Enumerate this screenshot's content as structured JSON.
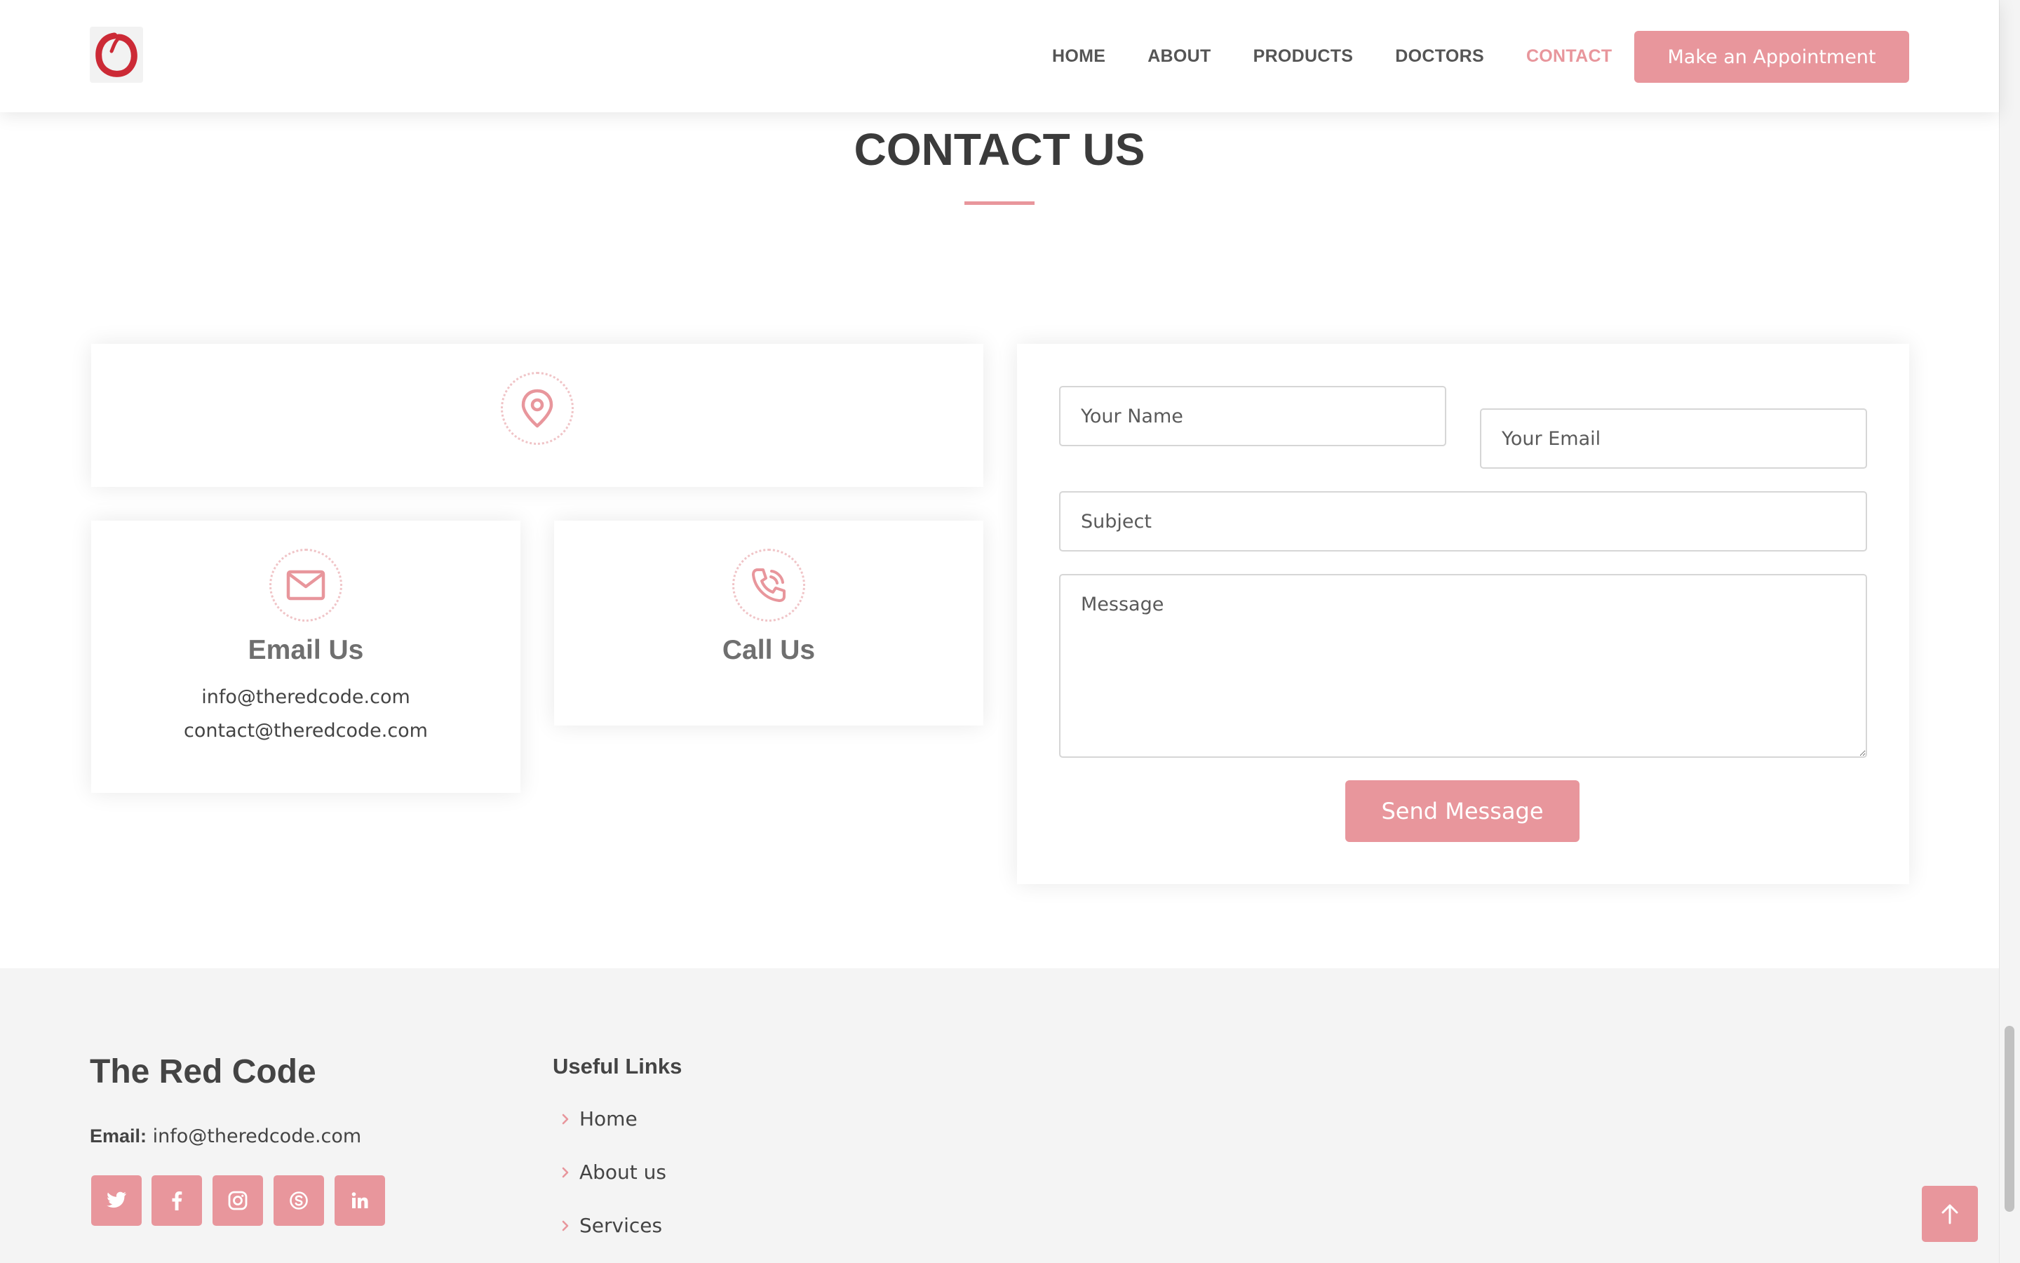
{
  "header": {
    "nav": [
      "HOME",
      "ABOUT",
      "PRODUCTS",
      "DOCTORS",
      "CONTACT"
    ],
    "active_nav": "CONTACT",
    "appointment_label": "Make an Appointment"
  },
  "section": {
    "title": "CONTACT US"
  },
  "info": {
    "location_icon": "map-pin-icon",
    "email": {
      "icon": "envelope-icon",
      "heading": "Email Us",
      "lines": [
        "info@theredcode.com",
        "contact@theredcode.com"
      ]
    },
    "call": {
      "icon": "phone-call-icon",
      "heading": "Call Us"
    }
  },
  "form": {
    "name_placeholder": "Your Name",
    "email_placeholder": "Your Email",
    "subject_placeholder": "Subject",
    "message_placeholder": "Message",
    "send_label": "Send Message"
  },
  "footer": {
    "brand": "The Red Code",
    "email_label": "Email:",
    "email_value": "info@theredcode.com",
    "social": [
      "twitter-icon",
      "facebook-icon",
      "instagram-icon",
      "skype-icon",
      "linkedin-icon"
    ],
    "links_title": "Useful Links",
    "links": [
      "Home",
      "About us",
      "Services"
    ]
  },
  "colors": {
    "accent": "#e8969c",
    "logo_red": "#cc2a36",
    "heading": "#3b3b3b",
    "footer_bg": "#f4f4f4"
  }
}
